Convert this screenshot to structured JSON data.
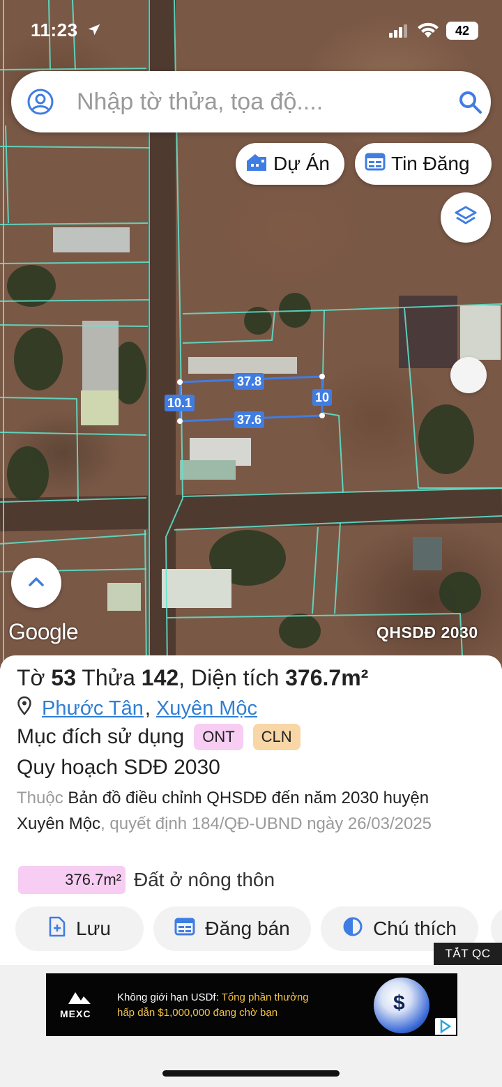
{
  "status_bar": {
    "time": "11:23",
    "battery": "42"
  },
  "search": {
    "placeholder": "Nhập tờ thửa, tọa độ...."
  },
  "chips": {
    "du_an": "Dự Án",
    "tin_dang": "Tin Đăng"
  },
  "map": {
    "dimensions": {
      "top": "37.8",
      "bottom": "37.6",
      "left": "10.1",
      "right": "10"
    },
    "google_label": "Google",
    "layer_label": "QHSDĐ 2030"
  },
  "parcel": {
    "sheet_label": "Tờ",
    "sheet_no": "53",
    "plot_label": "Thửa",
    "plot_no": "142",
    "area_label": "Diện tích",
    "area": "376.7m²",
    "ward": "Phước Tân",
    "district": "Xuyên Mộc",
    "purpose_label": "Mục đích sử dụng",
    "purpose_codes": [
      "ONT",
      "CLN"
    ],
    "plan_title": "Quy hoạch SDĐ 2030",
    "desc_prefix": "Thuộc",
    "desc_main": "Bản đồ điều chỉnh QHSDĐ đến năm 2030 huyện Xuyên Mộc",
    "desc_suffix": ", quyết định 184/QĐ-UBND ngày 26/03/2025",
    "zone_area": "376.7m²",
    "zone_name": "Đất ở nông thôn"
  },
  "actions": {
    "save": "Lưu",
    "post": "Đăng bán",
    "legend": "Chú thích"
  },
  "ad": {
    "close_label": "TẮT QC",
    "brand": "MEXC",
    "headline_white": "Không giới hạn USDf:",
    "headline_gold": " Tổng phần thưởng",
    "line2": "hấp dẫn $1,000,000 đang chờ bạn",
    "coin_symbol": "$"
  },
  "colors": {
    "accent": "#3f7de3",
    "link": "#2f7fd4",
    "parcel_line": "#5fe6cf",
    "ont": "#f7cdf3",
    "cln": "#f8d6a6"
  }
}
